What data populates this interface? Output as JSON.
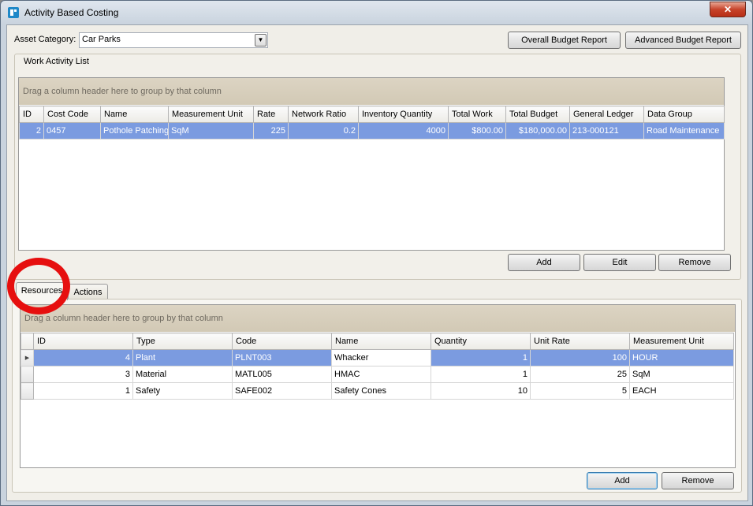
{
  "window": {
    "title": "Activity Based Costing",
    "close_glyph": "✕",
    "icon": "app-icon"
  },
  "top": {
    "asset_label": "Asset Category:",
    "asset_value": "Car Parks",
    "overall_report": "Overall Budget Report",
    "advanced_report": "Advanced Budget Report"
  },
  "activity": {
    "group_title": "Work Activity List",
    "group_hint": "Drag a column header here to group by that column",
    "columns": [
      "ID",
      "Cost Code",
      "Name",
      "Measurement Unit",
      "Rate",
      "Network Ratio",
      "Inventory Quantity",
      "Total Work",
      "Total Budget",
      "General Ledger",
      "Data Group"
    ],
    "rows": [
      [
        "2",
        "0457",
        "Pothole Patching",
        "SqM",
        "225",
        "0.2",
        "4000",
        "$800.00",
        "$180,000.00",
        "213-000121",
        "Road Maintenance"
      ]
    ],
    "add": "Add",
    "edit": "Edit",
    "remove": "Remove"
  },
  "tabs": {
    "resources": "Resources",
    "actions": "Actions"
  },
  "resources": {
    "group_hint": "Drag a column header here to group by that column",
    "columns": [
      "ID",
      "Type",
      "Code",
      "Name",
      "Quantity",
      "Unit Rate",
      "Measurement Unit"
    ],
    "rows": [
      [
        "4",
        "Plant",
        "PLNT003",
        "Whacker",
        "1",
        "100",
        "HOUR"
      ],
      [
        "3",
        "Material",
        "MATL005",
        "HMAC",
        "1",
        "25",
        "SqM"
      ],
      [
        "1",
        "Safety",
        "SAFE002",
        "Safety Cones",
        "10",
        "5",
        "EACH"
      ]
    ],
    "add": "Add",
    "remove": "Remove"
  },
  "colors": {
    "selection": "#7b9be0",
    "annotation": "#e60f0f"
  }
}
